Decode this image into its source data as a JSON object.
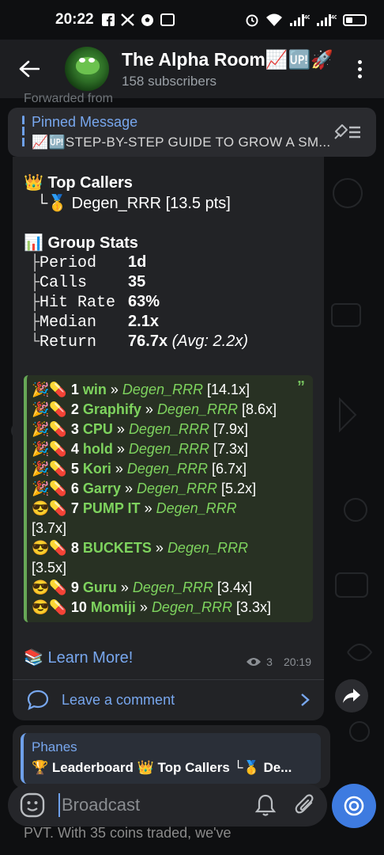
{
  "status_bar": {
    "time": "20:22",
    "left_icons": [
      "facebook-icon",
      "x-icon",
      "soccer-ball-icon",
      "news-icon"
    ],
    "right_icons": [
      "alarm-icon",
      "wifi-icon",
      "signal-4g-icon",
      "signal-4g-icon",
      "battery-icon"
    ],
    "network_label": "4G"
  },
  "header": {
    "title": "The Alpha Room📈🆙🚀",
    "subtitle": "158 subscribers"
  },
  "forwarded_label": "Forwarded from",
  "pinned": {
    "title": "Pinned Message",
    "text": "📈🆙STEP-BY-STEP GUIDE TO GROW A SM..."
  },
  "message": {
    "top_callers_title": "👑 Top Callers",
    "top_caller_line": "└🥇 Degen_RRR [13.5 pts]",
    "group_stats_title": "📊 Group Stats",
    "stats": [
      {
        "tree": "├",
        "key": "Period",
        "value": "1d",
        "extra": ""
      },
      {
        "tree": "├",
        "key": "Calls",
        "value": "35",
        "extra": ""
      },
      {
        "tree": "├",
        "key": "Hit Rate",
        "value": "63%",
        "extra": ""
      },
      {
        "tree": "├",
        "key": "Median",
        "value": "2.1x",
        "extra": ""
      },
      {
        "tree": "└",
        "key": "Return",
        "value": "76.7x",
        "extra": "(Avg: 2.2x)"
      }
    ],
    "quote_mark": "”",
    "calls": [
      {
        "emoji": "🎉💊",
        "num": "1",
        "token": "win",
        "sep": "»",
        "user": "Degen_RRR",
        "mult": "[14.1x]"
      },
      {
        "emoji": "🎉💊",
        "num": "2",
        "token": "Graphify",
        "sep": "»",
        "user": "Degen_RRR",
        "mult": "[8.6x]"
      },
      {
        "emoji": "🎉💊",
        "num": "3",
        "token": "CPU",
        "sep": "»",
        "user": "Degen_RRR",
        "mult": "[7.9x]"
      },
      {
        "emoji": "🎉💊",
        "num": "4",
        "token": "hold",
        "sep": "»",
        "user": "Degen_RRR",
        "mult": "[7.3x]"
      },
      {
        "emoji": "🎉💊",
        "num": "5",
        "token": "Kori",
        "sep": "»",
        "user": "Degen_RRR",
        "mult": "[6.7x]"
      },
      {
        "emoji": "🎉💊",
        "num": "6",
        "token": "Garry",
        "sep": "»",
        "user": "Degen_RRR",
        "mult": "[5.2x]"
      },
      {
        "emoji": "😎💊",
        "num": "7",
        "token": "PUMP IT",
        "sep": "»",
        "user": "Degen_RRR",
        "mult": "[3.7x]"
      },
      {
        "emoji": "😎💊",
        "num": "8",
        "token": "BUCKETS",
        "sep": "»",
        "user": "Degen_RRR",
        "mult": "[3.5x]"
      },
      {
        "emoji": "😎💊",
        "num": "9",
        "token": "Guru",
        "sep": "»",
        "user": "Degen_RRR",
        "mult": "[3.4x]"
      },
      {
        "emoji": "😎💊",
        "num": "10",
        "token": "Momiji",
        "sep": "»",
        "user": "Degen_RRR",
        "mult": "[3.3x]"
      }
    ],
    "learn_more": "📚 Learn More!",
    "views": "3",
    "time": "20:19",
    "comment_label": "Leave a comment"
  },
  "next_message": {
    "reply_name": "Phanes",
    "reply_text": "🏆 Leaderboard 👑 Top Callers └🥇 De...",
    "under_text": "PVT. With 35 coins traded, we've"
  },
  "input": {
    "placeholder": "Broadcast"
  },
  "colors": {
    "accent": "#78a7ee",
    "bubble_bg": "#222326",
    "quote_bg": "#283123",
    "green_link": "#7ed35e",
    "send_button": "#3e7be0"
  }
}
